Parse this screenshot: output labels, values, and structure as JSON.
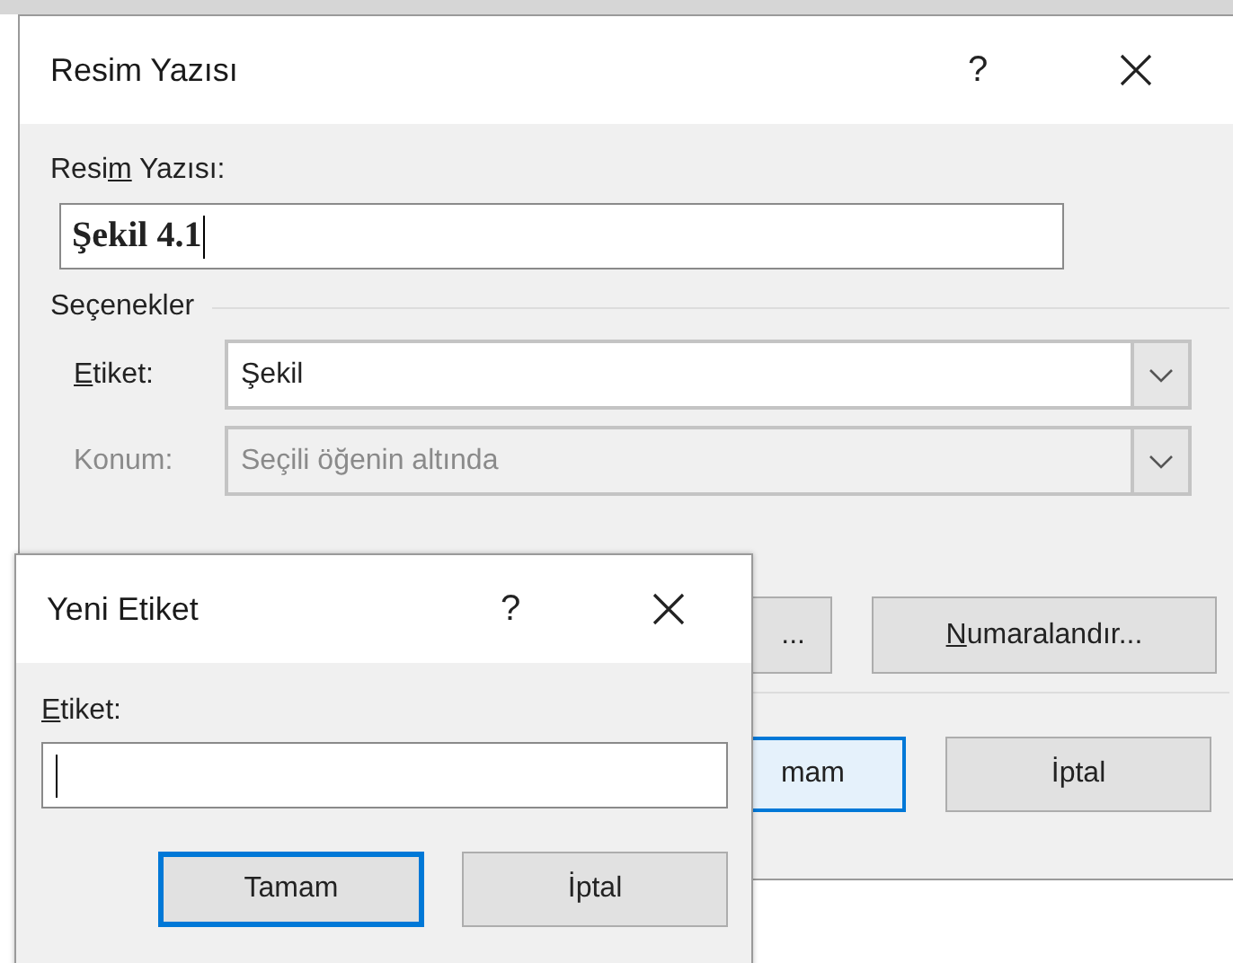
{
  "caption_dialog": {
    "title": "Resim Yazısı",
    "help": "?",
    "caption_label": [
      {
        "text": "Resi",
        "underline": false
      },
      {
        "text": "m",
        "underline": true
      },
      {
        "text": " Yazısı:",
        "underline": false
      }
    ],
    "caption_value": "Şekil 4.1",
    "options_heading": "Seçenekler",
    "fields": [
      {
        "kind": "combo",
        "label": [
          {
            "text": "E",
            "underline": true
          },
          {
            "text": "tiket:",
            "underline": false
          }
        ],
        "value": "Şekil",
        "disabled": false
      },
      {
        "kind": "combo",
        "label": [
          {
            "text": "Konum:",
            "underline": false
          }
        ],
        "value": "Seçili öğenin altında",
        "disabled": true
      }
    ],
    "tool_buttons": [
      {
        "label": [
          {
            "text": "...",
            "underline": false
          }
        ]
      },
      {
        "label": [
          {
            "text": "N",
            "underline": true
          },
          {
            "text": "umaralandır...",
            "underline": false
          }
        ]
      }
    ],
    "dialog_buttons": [
      {
        "label": [
          {
            "text": "mam",
            "underline": false
          }
        ],
        "default": true
      },
      {
        "label": [
          {
            "text": "İptal",
            "underline": false
          }
        ],
        "default": false
      }
    ]
  },
  "new_label_dialog": {
    "title": "Yeni Etiket",
    "help": "?",
    "field_label": [
      {
        "text": "E",
        "underline": true
      },
      {
        "text": "tiket:",
        "underline": false
      }
    ],
    "dialog_buttons": [
      {
        "label": [
          {
            "text": "Tamam",
            "underline": false
          }
        ],
        "default": true
      },
      {
        "label": [
          {
            "text": "İptal",
            "underline": false
          }
        ],
        "default": false
      }
    ]
  }
}
